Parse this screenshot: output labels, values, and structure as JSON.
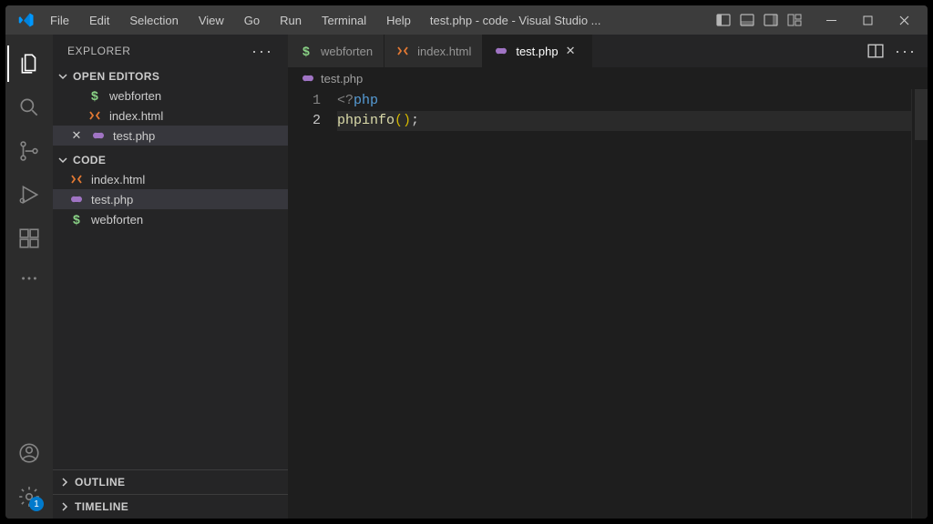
{
  "title": "test.php - code - Visual Studio ...",
  "menu": [
    "File",
    "Edit",
    "Selection",
    "View",
    "Go",
    "Run",
    "Terminal",
    "Help"
  ],
  "activitybar": {
    "badge": "1"
  },
  "sidebar": {
    "title": "EXPLORER",
    "open_editors_label": "OPEN EDITORS",
    "code_label": "CODE",
    "outline_label": "OUTLINE",
    "timeline_label": "TIMELINE",
    "open_editors": [
      {
        "name": "webforten",
        "icon": "dollar"
      },
      {
        "name": "index.html",
        "icon": "html"
      },
      {
        "name": "test.php",
        "icon": "php",
        "close": true
      }
    ],
    "code_items": [
      {
        "name": "index.html",
        "icon": "html"
      },
      {
        "name": "test.php",
        "icon": "php",
        "active": true
      },
      {
        "name": "webforten",
        "icon": "dollar"
      }
    ]
  },
  "tabs": [
    {
      "name": "webforten",
      "icon": "dollar"
    },
    {
      "name": "index.html",
      "icon": "html"
    },
    {
      "name": "test.php",
      "icon": "php",
      "active": true
    }
  ],
  "breadcrumb": {
    "icon": "php",
    "name": "test.php"
  },
  "code": {
    "lines": [
      "1",
      "2"
    ],
    "l1_open": "<?",
    "l1_tag": "php",
    "l2_fn": "phpinfo",
    "l2_paren_open": "(",
    "l2_paren_close": ")",
    "l2_semi": ";"
  }
}
